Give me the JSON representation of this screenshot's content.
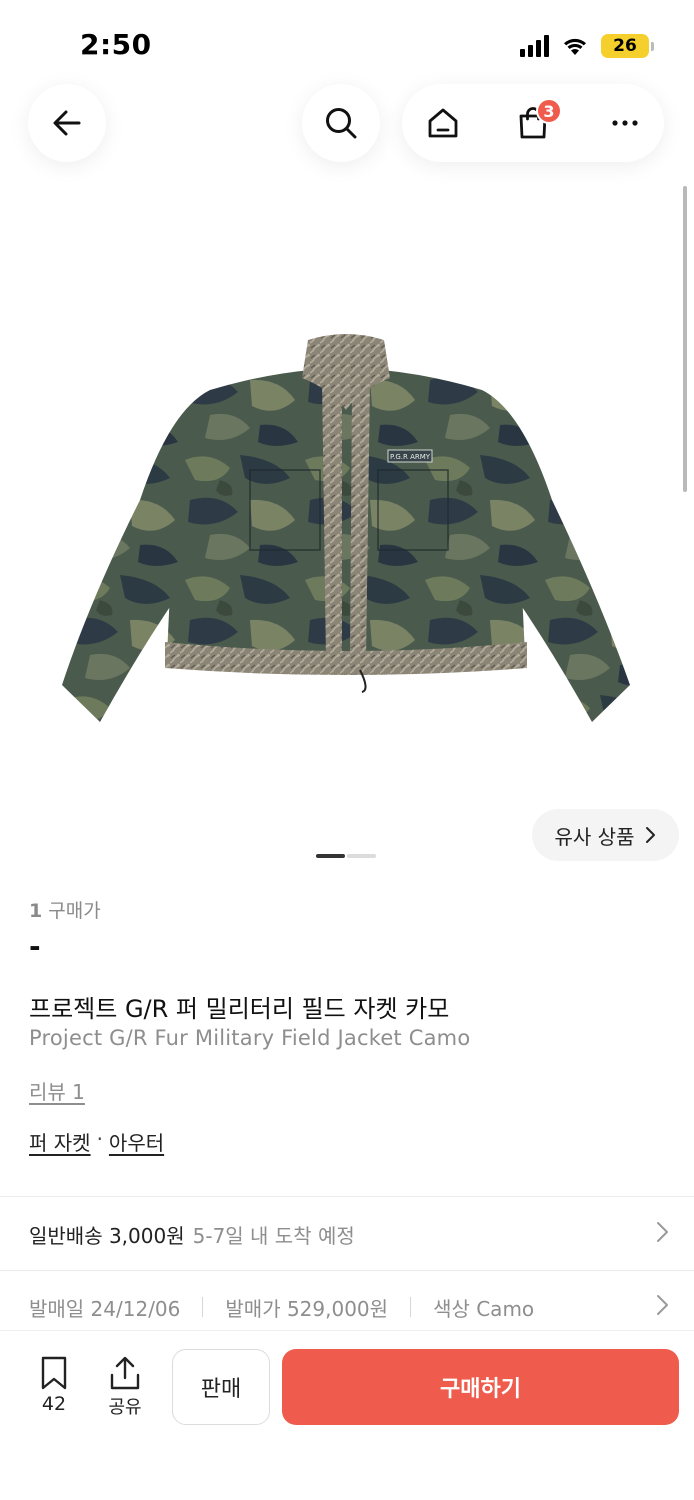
{
  "status_bar": {
    "time": "2:50",
    "battery": "26"
  },
  "top_nav": {
    "cart_count": "3"
  },
  "product": {
    "similar_label": "유사 상품",
    "buyer_count_number": "1",
    "buyer_count_label": "구매가",
    "price": "-",
    "title_ko": "프로젝트 G/R 퍼 밀리터리 필드 자켓 카모",
    "title_en": "Project G/R Fur Military Field Jacket Camo",
    "review_link": "리뷰 1",
    "categories": [
      "퍼 자켓",
      "아우터"
    ],
    "category_separator": "·",
    "image_patch_text": "P.G.R ARMY",
    "image_count": 2,
    "image_index": 1
  },
  "delivery": {
    "label": "일반배송 3,000원",
    "eta": "5-7일 내 도착 예정"
  },
  "meta": {
    "release_date": "발매일 24/12/06",
    "release_price": "발매가 529,000원",
    "color": "색상 Camo"
  },
  "bottom_bar": {
    "bookmark_count": "42",
    "share_label": "공유",
    "sell_label": "판매",
    "buy_label": "구매하기"
  },
  "colors": {
    "accent": "#ef5b4c",
    "battery": "#f5cf2b",
    "muted_text": "#8e8e8e"
  }
}
